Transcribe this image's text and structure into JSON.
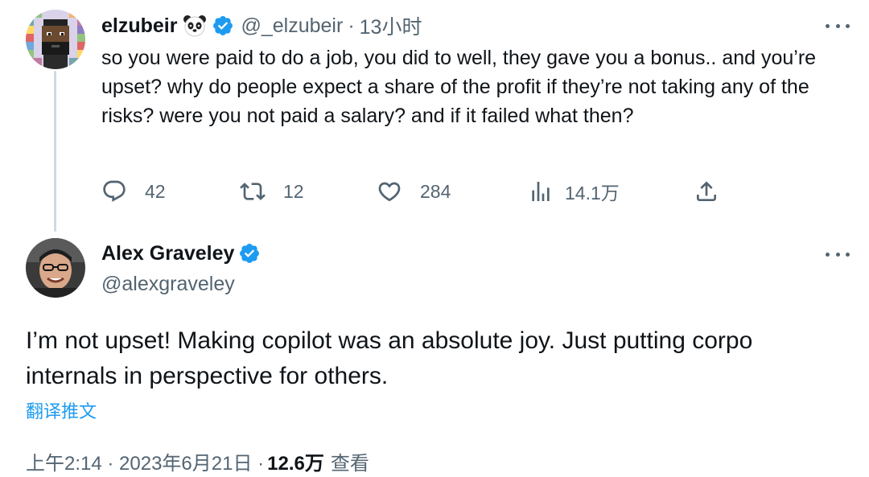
{
  "tweet1": {
    "author_name": "elzubeir",
    "handle": "@_elzubeir",
    "separator": "·",
    "time": "13小时",
    "text": "so you were paid to do a job, you did to well, they gave you a bonus.. and you’re upset? why do people expect a share of the profit if they’re not taking any of the risks? were you not paid a salary? and if it failed what then?",
    "actions": {
      "replies": "42",
      "retweets": "12",
      "likes": "284",
      "views": "14.1万"
    }
  },
  "tweet2": {
    "author_name": "Alex Graveley",
    "handle": "@alexgraveley",
    "text": "I’m not upset! Making copilot was an absolute joy. Just putting corpo internals in perspective for others.",
    "translate_label": "翻译推文",
    "timestamp": "上午2:14 · 2023年6月21日 ·",
    "views_count": "12.6万",
    "views_label": "查看"
  },
  "colors": {
    "text_primary": "#0f1419",
    "text_secondary": "#536471",
    "accent": "#1d9bf0",
    "thread_line": "#cfd9de"
  },
  "icons": [
    "panda-icon",
    "verified-badge-icon",
    "more-icon",
    "reply-icon",
    "retweet-icon",
    "like-icon",
    "views-icon",
    "share-icon"
  ]
}
